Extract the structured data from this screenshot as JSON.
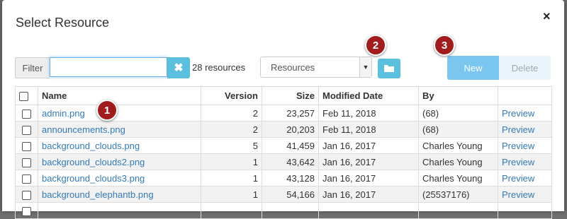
{
  "dialog": {
    "title": "Select Resource",
    "close_label": "×"
  },
  "filter": {
    "label": "Filter",
    "value": "",
    "clear_label": "✖"
  },
  "resource_count": "28 resources",
  "type_select": {
    "selected": "Resources"
  },
  "toolbar": {
    "new_label": "New",
    "delete_label": "Delete"
  },
  "markers": [
    "1",
    "2",
    "3"
  ],
  "table": {
    "columns": [
      "Name",
      "Version",
      "Size",
      "Modified Date",
      "By",
      ""
    ],
    "rows": [
      {
        "name": "admin.png",
        "version": "2",
        "size": "23,257",
        "date": "Feb 11, 2018",
        "by": "(68)",
        "action": "Preview"
      },
      {
        "name": "announcements.png",
        "version": "2",
        "size": "20,203",
        "date": "Feb 11, 2018",
        "by": "(68)",
        "action": "Preview"
      },
      {
        "name": "background_clouds.png",
        "version": "5",
        "size": "41,459",
        "date": "Jan 16, 2017",
        "by": "Charles Young",
        "action": "Preview"
      },
      {
        "name": "background_clouds2.png",
        "version": "1",
        "size": "43,642",
        "date": "Jan 16, 2017",
        "by": "Charles Young",
        "action": "Preview"
      },
      {
        "name": "background_clouds3.png",
        "version": "1",
        "size": "43,128",
        "date": "Jan 16, 2017",
        "by": "Charles Young",
        "action": "Preview"
      },
      {
        "name": "background_elephantb.png",
        "version": "1",
        "size": "54,166",
        "date": "Jan 16, 2017",
        "by": "(25537176)",
        "action": "Preview"
      }
    ]
  },
  "colors": {
    "accent": "#5bc0de",
    "marker": "#a11c1c",
    "link": "#337ab7"
  }
}
